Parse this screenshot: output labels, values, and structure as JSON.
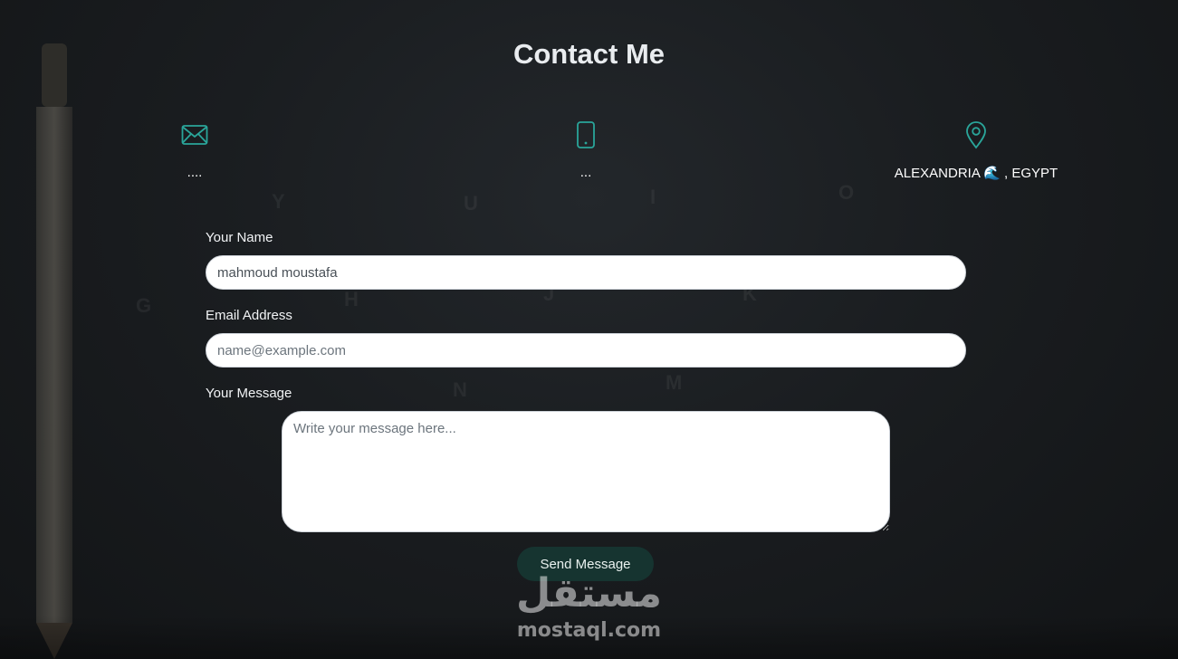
{
  "page": {
    "title": "Contact Me"
  },
  "contact_info": [
    {
      "icon": "envelope-icon",
      "text": "...."
    },
    {
      "icon": "mobile-phone-icon",
      "text": "..."
    },
    {
      "icon": "location-pin-icon",
      "text": "ALEXANDRIA 🌊 , EGYPT"
    }
  ],
  "form": {
    "name": {
      "label": "Your Name",
      "value": "mahmoud moustafa",
      "placeholder": ""
    },
    "email": {
      "label": "Email Address",
      "value": "",
      "placeholder": "name@example.com"
    },
    "message": {
      "label": "Your Message",
      "value": "",
      "placeholder": "Write your message here..."
    },
    "submit_label": "Send Message"
  },
  "watermark": {
    "arabic": "مستقل",
    "latin": "mostaql.com"
  },
  "colors": {
    "accent": "#2aa59a",
    "button": "#163430",
    "background": "#1a1d20"
  }
}
